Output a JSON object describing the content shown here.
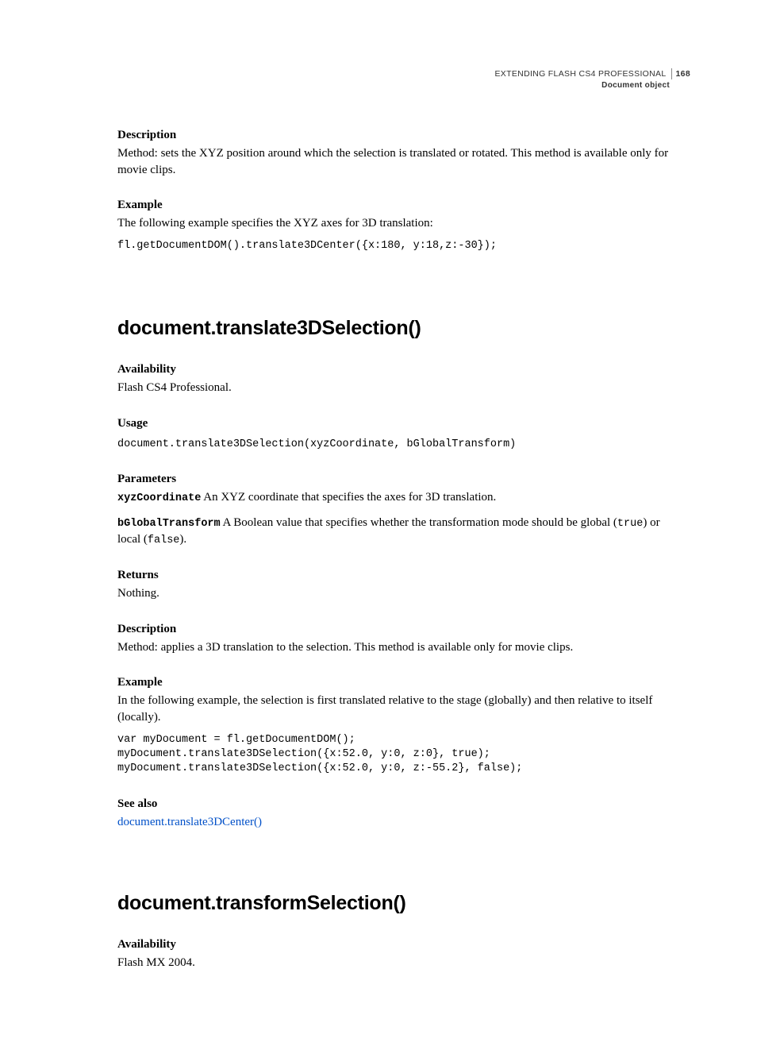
{
  "header": {
    "doc_title": "EXTENDING FLASH CS4 PROFESSIONAL",
    "page_number": "168",
    "section": "Document object"
  },
  "s0": {
    "desc_h": "Description",
    "desc_p": "Method: sets the XYZ position around which the selection is translated or rotated. This method is available only for movie clips.",
    "ex_h": "Example",
    "ex_p": "The following example specifies the XYZ axes for 3D translation:",
    "ex_code": "fl.getDocumentDOM().translate3DCenter({x:180, y:18,z:-30});"
  },
  "s1": {
    "title": "document.translate3DSelection()",
    "avail_h": "Availability",
    "avail_p": "Flash CS4 Professional.",
    "usage_h": "Usage",
    "usage_code": "document.translate3DSelection(xyzCoordinate, bGlobalTransform)",
    "params_h": "Parameters",
    "param1_name": "xyzCoordinate",
    "param1_desc": " An XYZ coordinate that specifies the axes for 3D translation.",
    "param2_name": "bGlobalTransform",
    "param2_desc_a": " A Boolean value that specifies whether the transformation mode should be global (",
    "param2_true": "true",
    "param2_desc_b": ") or local (",
    "param2_false": "false",
    "param2_desc_c": ").",
    "returns_h": "Returns",
    "returns_p": "Nothing.",
    "desc_h": "Description",
    "desc_p": "Method: applies a 3D translation to the selection. This method is available only for movie clips.",
    "ex_h": "Example",
    "ex_p": "In the following example, the selection is first translated relative to the stage (globally) and then relative to itself (locally).",
    "ex_code": "var myDocument = fl.getDocumentDOM();\nmyDocument.translate3DSelection({x:52.0, y:0, z:0}, true);\nmyDocument.translate3DSelection({x:52.0, y:0, z:-55.2}, false);",
    "see_h": "See also",
    "see_link": "document.translate3DCenter()"
  },
  "s2": {
    "title": "document.transformSelection()",
    "avail_h": "Availability",
    "avail_p": "Flash MX 2004."
  }
}
